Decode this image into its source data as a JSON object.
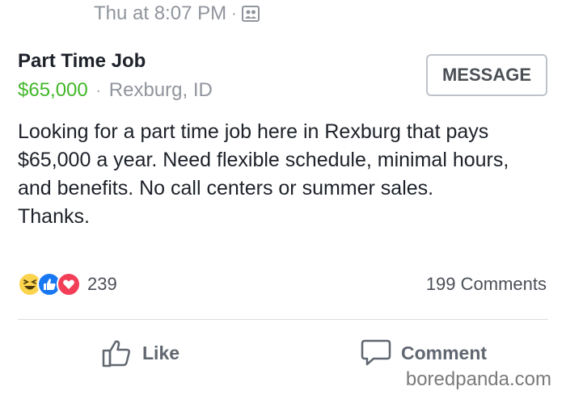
{
  "meta": {
    "timestamp": "Thu at 8:07 PM",
    "dot": "·",
    "audience_icon": "group-icon"
  },
  "listing": {
    "title": "Part Time Job",
    "price": "$65,000",
    "separator": "·",
    "location": "Rexburg, ID"
  },
  "message_button": {
    "label": "MESSAGE"
  },
  "post": {
    "text": "Looking for a part time job here in Rexburg that pays\n$65,000 a year. Need flexible schedule, minimal hours,\nand benefits. No call centers or summer sales.\nThanks."
  },
  "reactions": {
    "icons": [
      "haha-icon",
      "like-icon",
      "love-icon"
    ],
    "count": "239"
  },
  "comments": {
    "count_label": "199 Comments"
  },
  "actions": {
    "like": "Like",
    "comment": "Comment"
  },
  "watermark": "boredpanda.com",
  "colors": {
    "price_green": "#42b72a",
    "like_blue": "#1877f2",
    "love_red": "#f33e58",
    "haha_yellow": "#fcd34d"
  }
}
